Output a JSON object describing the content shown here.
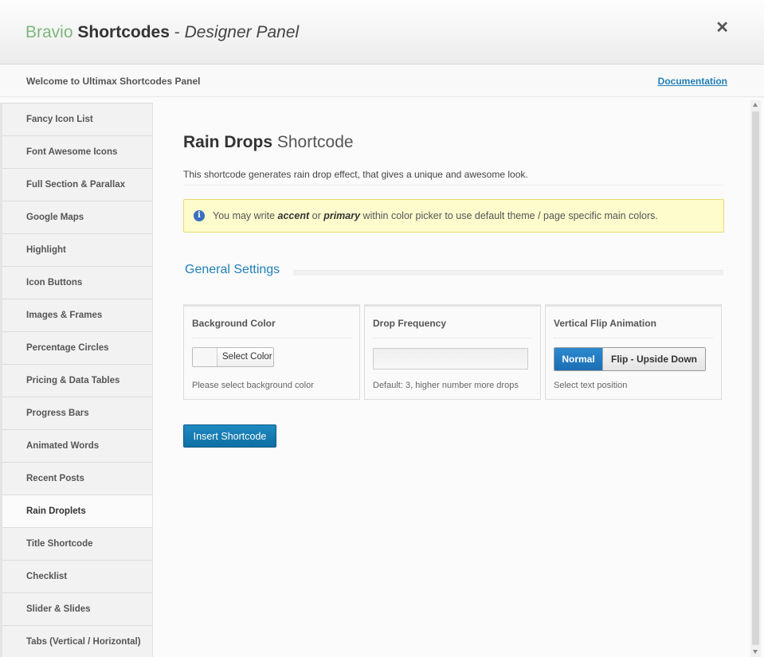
{
  "header": {
    "brand": "Bravio",
    "product": "Shortcodes",
    "separator": " - ",
    "subtitle": "Designer Panel",
    "close_glyph": "✕"
  },
  "welcome": {
    "message": "Welcome to Ultimax Shortcodes Panel",
    "doc_link": "Documentation"
  },
  "sidebar": {
    "items": [
      {
        "label": "Fancy Icon List"
      },
      {
        "label": "Font Awesome Icons"
      },
      {
        "label": "Full Section & Parallax"
      },
      {
        "label": "Google Maps"
      },
      {
        "label": "Highlight"
      },
      {
        "label": "Icon Buttons"
      },
      {
        "label": "Images & Frames"
      },
      {
        "label": "Percentage Circles"
      },
      {
        "label": "Pricing & Data Tables"
      },
      {
        "label": "Progress Bars"
      },
      {
        "label": "Animated Words"
      },
      {
        "label": "Recent Posts"
      },
      {
        "label": "Rain Droplets"
      },
      {
        "label": "Title Shortcode"
      },
      {
        "label": "Checklist"
      },
      {
        "label": "Slider & Slides"
      },
      {
        "label": "Tabs (Vertical / Horizontal)"
      }
    ],
    "active_label": "Rain Droplets"
  },
  "main": {
    "title_bold": "Rain Drops",
    "title_light": "Shortcode",
    "description": "This shortcode generates rain drop effect, that gives a unique and awesome look.",
    "notice": {
      "icon": "info-icon",
      "prefix": "You may write ",
      "word1": "accent",
      "middle": " or ",
      "word2": "primary",
      "suffix": " within color picker to use default theme / page specific main colors."
    },
    "section_title": "General Settings",
    "fields": {
      "background_color": {
        "label": "Background Color",
        "button_label": "Select Color",
        "hint": "Please select background color"
      },
      "drop_frequency": {
        "label": "Drop Frequency",
        "value": "",
        "hint": "Default: 3, higher number more drops"
      },
      "vertical_flip": {
        "label": "Vertical Flip Animation",
        "option_on": "Normal",
        "option_off": "Flip - Upside Down",
        "selected": "Normal",
        "hint": "Select text position"
      }
    },
    "insert_button": "Insert Shortcode"
  },
  "colors": {
    "brand_green": "#7fb77e",
    "link_blue": "#1f7fb6",
    "button_blue": "#1b7db8",
    "notice_bg": "#fefbcd"
  }
}
